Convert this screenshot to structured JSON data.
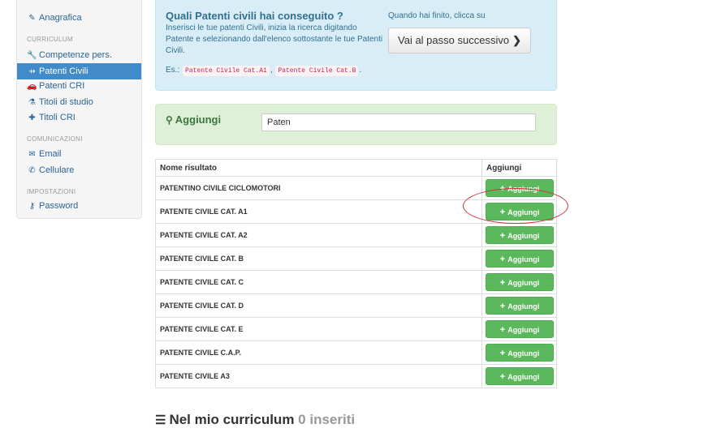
{
  "sidebar": {
    "items": [
      {
        "label": "Anagrafica",
        "icon": "edit-icon",
        "glyph": "✎",
        "active": false
      },
      {
        "label": "Competenze pers.",
        "icon": "wrench-icon",
        "glyph": "🔧",
        "active": false
      },
      {
        "label": "Patenti Civili",
        "icon": "road-icon",
        "glyph": "⇸",
        "active": true
      },
      {
        "label": "Patenti CRI",
        "icon": "car-icon",
        "glyph": "🚗",
        "active": false
      },
      {
        "label": "Titoli di studio",
        "icon": "flask-icon",
        "glyph": "⚗",
        "active": false
      },
      {
        "label": "Titoli CRI",
        "icon": "plus-square-icon",
        "glyph": "✚",
        "active": false
      },
      {
        "label": "Email",
        "icon": "envelope-icon",
        "glyph": "✉",
        "active": false
      },
      {
        "label": "Cellulare",
        "icon": "phone-icon",
        "glyph": "✆",
        "active": false
      },
      {
        "label": "Password",
        "icon": "key-icon",
        "glyph": "⚷",
        "active": false
      }
    ],
    "headers": {
      "curriculum": "CURRICULUM",
      "comunicazioni": "COMUNICAZIONI",
      "impostazioni": "IMPOSTAZIONI"
    }
  },
  "info": {
    "title": "Quali Patenti civili hai conseguito ?",
    "description": "Inserisci le tue patenti Civili, inizia la ricerca digitando Patente e selezionando dall'elenco sottostante le tue Patenti Civili.",
    "example_label": "Es.:",
    "examples": [
      "Patente Civile Cat.A1",
      "Patente Civile Cat.B"
    ],
    "next_label": "Quando hai finito, clicca su",
    "next_button": "Vai al passo successivo"
  },
  "search": {
    "label": "Aggiungi",
    "value": "Paten"
  },
  "table": {
    "headers": {
      "name": "Nome risultato",
      "add": "Aggiungi"
    },
    "add_label": "Aggiungi",
    "rows": [
      "PATENTINO CIVILE CICLOMOTORI",
      "PATENTE CIVILE CAT. A1",
      "PATENTE CIVILE CAT. A2",
      "PATENTE CIVILE CAT. B",
      "PATENTE CIVILE CAT. C",
      "PATENTE CIVILE CAT. D",
      "PATENTE CIVILE CAT. E",
      "PATENTE CIVILE C.A.P.",
      "PATENTE CIVILE A3"
    ]
  },
  "curriculum": {
    "title": "Nel mio curriculum",
    "count": "0",
    "suffix": "inseriti"
  },
  "colors": {
    "primary": "#428bca",
    "success": "#5cb85c",
    "info_bg": "#d9edf7",
    "success_bg": "#dff0d8",
    "highlight": "#c8353a"
  }
}
